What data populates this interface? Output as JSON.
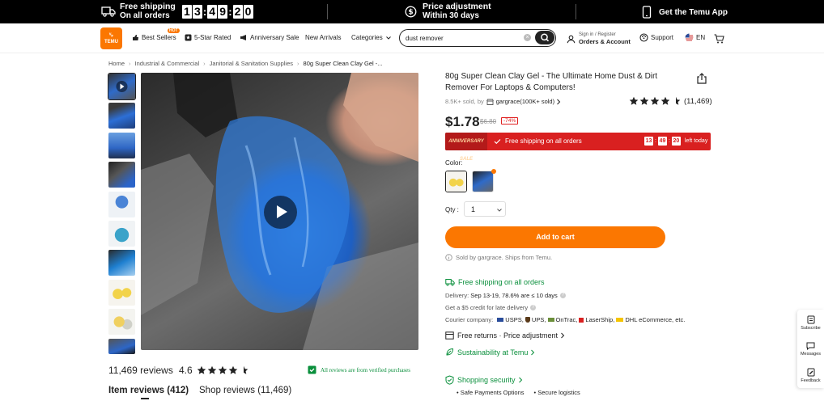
{
  "topbar": {
    "free_shipping_l1": "Free shipping",
    "free_shipping_l2": "On all orders",
    "timer": [
      "1",
      "3",
      "4",
      "9",
      "2",
      "0"
    ],
    "price_adj_l1": "Price adjustment",
    "price_adj_l2": "Within 30 days",
    "app_label": "Get the Temu App"
  },
  "header": {
    "logo_l1": "ᵛᵢᵣ",
    "logo_l2": "TEMU",
    "nav": [
      {
        "label": "Best Sellers",
        "badge": "HOT"
      },
      {
        "label": "5-Star Rated"
      },
      {
        "label": "Anniversary Sale"
      },
      {
        "label": "New Arrivals"
      },
      {
        "label": "Categories"
      }
    ],
    "search_value": "dust remover",
    "account_small": "Sign in / Register",
    "account_big": "Orders & Account",
    "support": "Support",
    "lang": "EN"
  },
  "breadcrumb": [
    "Home",
    "Industrial & Commercial",
    "Janitorial & Sanitation Supplies",
    "80g Super Clean Clay Gel -..."
  ],
  "product": {
    "title": "80g Super Clean Clay Gel - The Ultimate Home Dust & Dirt Remover For Laptops & Computers!",
    "sold": "8.5K+ sold, by",
    "seller": "gargrace(100K+ sold)",
    "rating_count": "(11,469)",
    "rating_value": 4.6,
    "price": "$1.78",
    "old_price": "$6.80",
    "discount": "-74%",
    "promo_badge": "ANNIVERSARY SALE",
    "promo_text": "Free shipping on all orders",
    "promo_timer": [
      "13",
      "49",
      "20"
    ],
    "promo_tail": "left today",
    "color_label": "Color:",
    "qty_label": "Qty :",
    "qty_value": "1",
    "add_to_cart": "Add to cart",
    "sold_by": "Sold by gargrace. Ships from Temu."
  },
  "shipping": {
    "title": "Free shipping on all orders",
    "delivery_label": "Delivery:",
    "delivery_value": "Sep 13-19, 78.6% are ≤ 10 days",
    "credit": "Get a $5 credit for late delivery",
    "courier_label": "Courier company:",
    "couriers": [
      "USPS,",
      "UPS,",
      "OnTrac,",
      "LaserShip,",
      "DHL eCommerce, etc."
    ],
    "returns": "Free returns · Price adjustment",
    "sustain": "Sustainability at Temu",
    "security": "Shopping security",
    "sec_items": [
      "Safe Payments Options",
      "Secure logistics"
    ]
  },
  "reviews": {
    "count": "11,469 reviews",
    "score": "4.6",
    "verified": "All reviews are from verified purchases",
    "tab_items": "Item reviews (412)",
    "tab_shop": "Shop reviews (11,469)"
  },
  "floating": [
    "Subscribe",
    "Messages",
    "Feedback"
  ],
  "colors": {
    "accent": "#fb7701",
    "promo": "#d92020",
    "green": "#0a8f3c"
  }
}
